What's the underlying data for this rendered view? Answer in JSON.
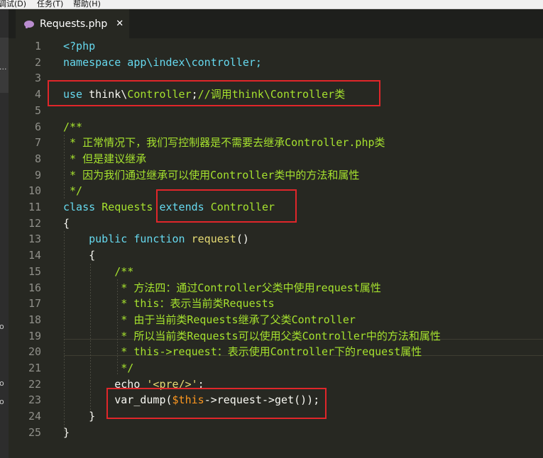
{
  "menubar": {
    "items": [
      "调试(D)",
      "任务(T)",
      "帮助(H)"
    ]
  },
  "leftstrip": {
    "marks": [
      "...",
      "o",
      "o",
      "o"
    ]
  },
  "tab": {
    "title": "Requests.php",
    "close": "✕"
  },
  "colors": {
    "background": "#272822",
    "highlight_box": "#e0262a",
    "keyword": "#66d9ef",
    "classname": "#a6e22e",
    "comment": "#a6e22e",
    "string": "#e6db74",
    "variable": "#fd971f"
  },
  "editor": {
    "line_numbers": [
      "1",
      "2",
      "3",
      "4",
      "5",
      "6",
      "7",
      "8",
      "9",
      "10",
      "11",
      "12",
      "13",
      "14",
      "15",
      "16",
      "17",
      "18",
      "19",
      "20",
      "21",
      "22",
      "23",
      "24",
      "25"
    ],
    "code": {
      "l1": "<?php",
      "l2_kw": "namespace",
      "l2_rest": " app\\index\\controller;",
      "l4_kw": "use",
      "l4_ns": " think\\",
      "l4_cls": "Controller",
      "l4_semi": ";",
      "l4_comment": "//调用think\\Controller类",
      "l6": "/**",
      "l7": " * 正常情况下，我们写控制器是不需要去继承Controller.php类",
      "l8": " * 但是建议继承",
      "l9": " * 因为我们通过继承可以使用Controller类中的方法和属性",
      "l10": " */",
      "l11_kw": "class",
      "l11_cls": "Requests",
      "l11_ext": "extends",
      "l11_parent": "Controller",
      "l12": "{",
      "l13_pub": "public",
      "l13_fn": "function",
      "l13_name": "request",
      "l13_paren": "()",
      "l14": "{",
      "l15": "/**",
      "l16": " * 方法四：通过Controller父类中使用request属性",
      "l17": " * this：表示当前类Requests",
      "l18": " * 由于当前类Requests继承了父类Controller",
      "l19": " * 所以当前类Requests可以使用父类Controller中的方法和属性",
      "l20": " * this->request：表示使用Controller下的request属性",
      "l21": " */",
      "l22_echo": "echo",
      "l22_str": "'<pre/>'",
      "l22_semi": ";",
      "l23_fn": "var_dump(",
      "l23_this": "$this",
      "l23_arrow1": "->",
      "l23_prop": "request",
      "l23_arrow2": "->",
      "l23_get": "get",
      "l23_end": "());",
      "l24": "}",
      "l25": "}"
    }
  }
}
